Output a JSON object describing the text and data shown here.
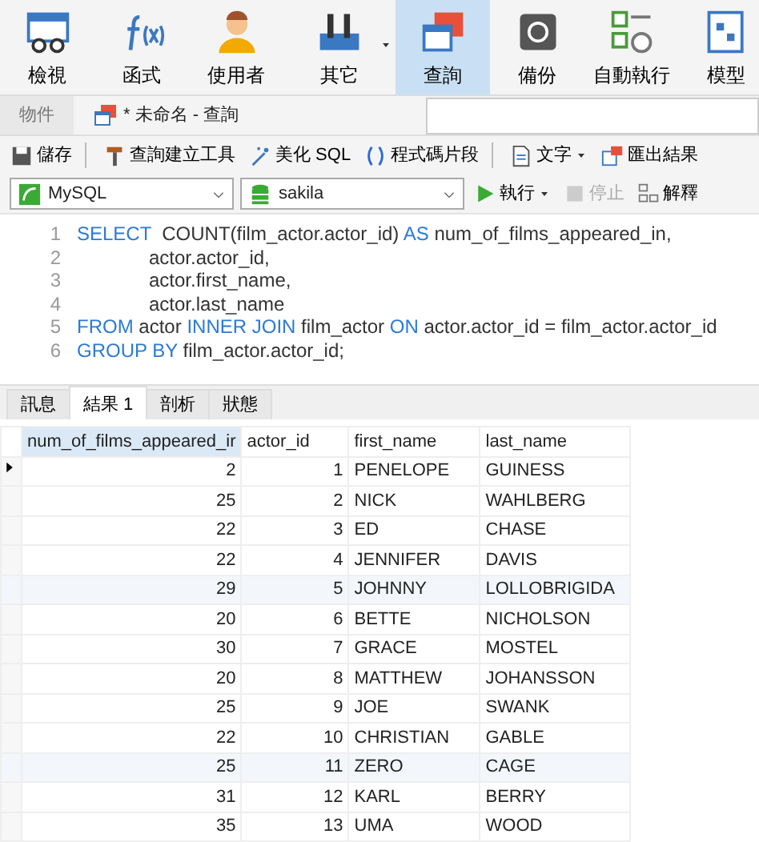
{
  "ribbon": [
    {
      "label": "檢視",
      "selected": false,
      "dropdown": false
    },
    {
      "label": "函式",
      "selected": false,
      "dropdown": false
    },
    {
      "label": "使用者",
      "selected": false,
      "dropdown": false
    },
    {
      "label": "其它",
      "selected": false,
      "dropdown": true
    },
    {
      "label": "查詢",
      "selected": true,
      "dropdown": false
    },
    {
      "label": "備份",
      "selected": false,
      "dropdown": false
    },
    {
      "label": "自動執行",
      "selected": false,
      "dropdown": false
    },
    {
      "label": "模型",
      "selected": false,
      "dropdown": false
    }
  ],
  "doc_tabs": [
    {
      "label": "物件",
      "selected": false
    },
    {
      "label": "* 未命名 - 查詢",
      "selected": true
    }
  ],
  "toolbar": [
    {
      "label": "儲存",
      "dropdown": false,
      "separator_after": true
    },
    {
      "label": "查詢建立工具",
      "dropdown": false,
      "separator_after": false
    },
    {
      "label": "美化 SQL",
      "dropdown": false,
      "separator_after": false
    },
    {
      "label": "程式碼片段",
      "dropdown": false,
      "separator_after": true
    },
    {
      "label": "文字",
      "dropdown": true,
      "separator_after": false
    },
    {
      "label": "匯出結果",
      "dropdown": false,
      "separator_after": false
    }
  ],
  "connection": {
    "value": "MySQL"
  },
  "database": {
    "value": "sakila"
  },
  "run_controls": [
    {
      "label": "執行",
      "dropdown": true,
      "disabled": false
    },
    {
      "label": "停止",
      "dropdown": false,
      "disabled": true
    },
    {
      "label": "解釋",
      "dropdown": false,
      "disabled": false
    }
  ],
  "editor": {
    "lines": [
      {
        "number": "1",
        "indented": false,
        "tokens": [
          {
            "kind": "keyword",
            "text": "SELECT"
          },
          {
            "kind": "text",
            "text": "  COUNT(film_actor.actor_id) "
          },
          {
            "kind": "keyword",
            "text": "AS"
          },
          {
            "kind": "text",
            "text": " num_of_films_appeared_in,"
          }
        ]
      },
      {
        "number": "2",
        "indented": true,
        "tokens": [
          {
            "kind": "text",
            "text": "actor.actor_id,"
          }
        ]
      },
      {
        "number": "3",
        "indented": true,
        "tokens": [
          {
            "kind": "text",
            "text": "actor.first_name,"
          }
        ]
      },
      {
        "number": "4",
        "indented": true,
        "tokens": [
          {
            "kind": "text",
            "text": "actor.last_name"
          }
        ]
      },
      {
        "number": "5",
        "indented": false,
        "tokens": [
          {
            "kind": "keyword",
            "text": "FROM"
          },
          {
            "kind": "text",
            "text": " actor "
          },
          {
            "kind": "keyword",
            "text": "INNER JOIN"
          },
          {
            "kind": "text",
            "text": " film_actor "
          },
          {
            "kind": "keyword",
            "text": "ON"
          },
          {
            "kind": "text",
            "text": " actor.actor_id = film_actor.actor_id"
          }
        ]
      },
      {
        "number": "6",
        "indented": false,
        "tokens": [
          {
            "kind": "keyword",
            "text": "GROUP BY"
          },
          {
            "kind": "text",
            "text": " film_actor.actor_id;"
          }
        ]
      }
    ]
  },
  "result_tabs": [
    {
      "label": "訊息",
      "selected": false
    },
    {
      "label": "結果 1",
      "selected": true
    },
    {
      "label": "剖析",
      "selected": false
    },
    {
      "label": "狀態",
      "selected": false
    }
  ],
  "table": {
    "columns": [
      {
        "label": "num_of_films_appeared_ir",
        "selected": true
      },
      {
        "label": "actor_id",
        "selected": false
      },
      {
        "label": "first_name",
        "selected": false
      },
      {
        "label": "last_name",
        "selected": false
      }
    ],
    "rows": [
      {
        "current": true,
        "cells": [
          "2",
          "1",
          "PENELOPE",
          "GUINESS"
        ]
      },
      {
        "current": false,
        "cells": [
          "25",
          "2",
          "NICK",
          "WAHLBERG"
        ]
      },
      {
        "current": false,
        "cells": [
          "22",
          "3",
          "ED",
          "CHASE"
        ]
      },
      {
        "current": false,
        "cells": [
          "22",
          "4",
          "JENNIFER",
          "DAVIS"
        ]
      },
      {
        "current": false,
        "cells": [
          "29",
          "5",
          "JOHNNY",
          "LOLLOBRIGIDA"
        ]
      },
      {
        "current": false,
        "cells": [
          "20",
          "6",
          "BETTE",
          "NICHOLSON"
        ]
      },
      {
        "current": false,
        "cells": [
          "30",
          "7",
          "GRACE",
          "MOSTEL"
        ]
      },
      {
        "current": false,
        "cells": [
          "20",
          "8",
          "MATTHEW",
          "JOHANSSON"
        ]
      },
      {
        "current": false,
        "cells": [
          "25",
          "9",
          "JOE",
          "SWANK"
        ]
      },
      {
        "current": false,
        "cells": [
          "22",
          "10",
          "CHRISTIAN",
          "GABLE"
        ]
      },
      {
        "current": false,
        "cells": [
          "25",
          "11",
          "ZERO",
          "CAGE"
        ]
      },
      {
        "current": false,
        "cells": [
          "31",
          "12",
          "KARL",
          "BERRY"
        ]
      },
      {
        "current": false,
        "cells": [
          "35",
          "13",
          "UMA",
          "WOOD"
        ]
      }
    ]
  }
}
